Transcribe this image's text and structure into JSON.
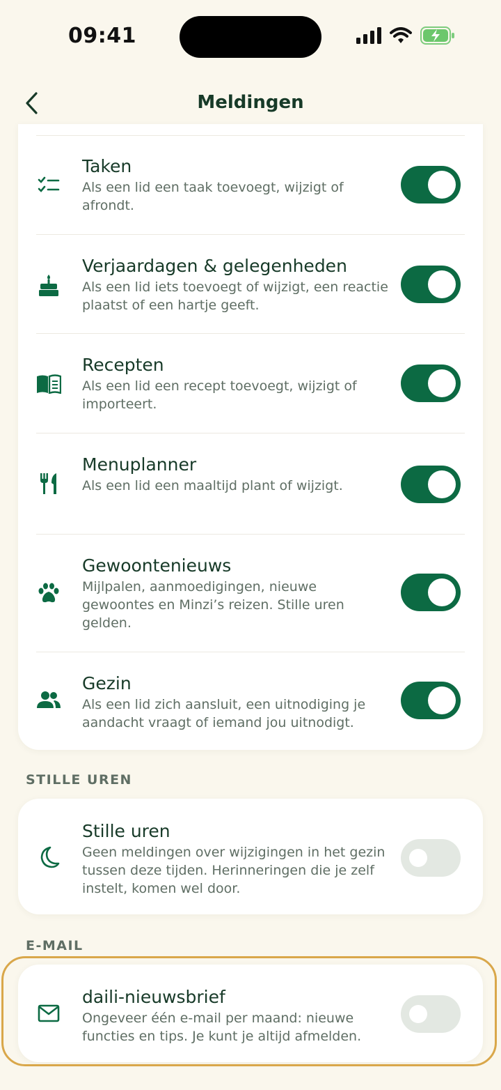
{
  "status": {
    "time": "09:41"
  },
  "nav": {
    "title": "Meldingen"
  },
  "items": [
    {
      "title": "Taken",
      "desc": "Als een lid een taak toevoegt, wijzigt of afrondt.",
      "icon": "checklist-icon",
      "on": true
    },
    {
      "title": "Verjaardagen & gelegenheden",
      "desc": "Als een lid iets toevoegt of wijzigt, een reactie plaatst of een hartje geeft.",
      "icon": "cake-icon",
      "on": true
    },
    {
      "title": "Recepten",
      "desc": "Als een lid een recept toevoegt, wijzigt of importeert.",
      "icon": "book-icon",
      "on": true
    },
    {
      "title": "Menuplanner",
      "desc": "Als een lid een maaltijd plant of wijzigt.",
      "icon": "cutlery-icon",
      "on": true
    },
    {
      "title": "Gewoontenieuws",
      "desc": "Mijlpalen, aanmoedigingen, nieuwe gewoontes en Minzi’s reizen. Stille uren gelden.",
      "icon": "paw-icon",
      "on": true
    },
    {
      "title": "Gezin",
      "desc": "Als een lid zich aansluit, een uitnodiging je aandacht vraagt of iemand jou uitnodigt.",
      "icon": "people-icon",
      "on": true
    }
  ],
  "quiet": {
    "section": "STILLE UREN",
    "title": "Stille uren",
    "desc": "Geen meldingen over wijzigingen in het gezin tussen deze tijden. Herinneringen die je zelf instelt, komen wel door.",
    "on": false
  },
  "email": {
    "section": "E-MAIL",
    "title": "daili-nieuwsbrief",
    "desc": "Ongeveer één e-mail per maand: nieuwe functies en tips. Je kunt je altijd afmelden.",
    "on": false
  },
  "colors": {
    "accent": "#0c6a43",
    "background": "#FAF7ED",
    "highlight": "#D9A74A"
  }
}
